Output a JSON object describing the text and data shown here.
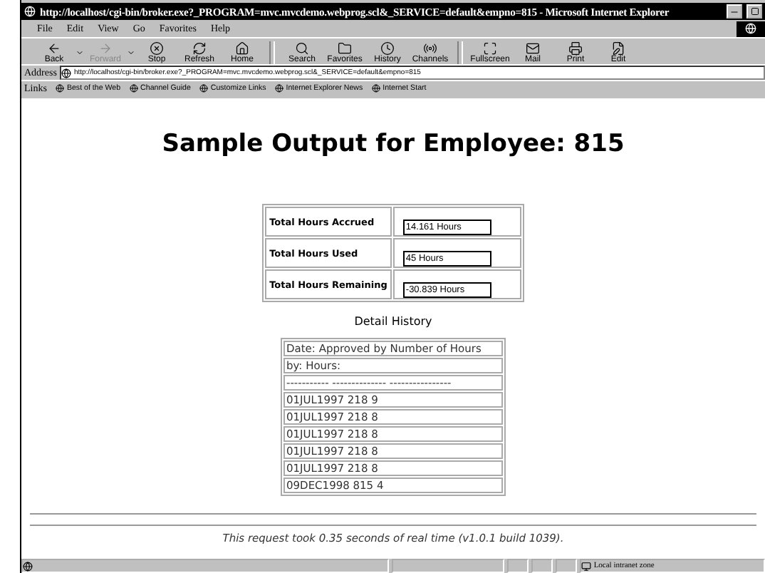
{
  "window": {
    "title": "http://localhost/cgi-bin/broker.exe?_PROGRAM=mvc.mvcdemo.webprog.scl&_SERVICE=default&empno=815 - Microsoft Internet Explorer"
  },
  "menu": [
    "File",
    "Edit",
    "View",
    "Go",
    "Favorites",
    "Help"
  ],
  "toolbar": [
    {
      "label": "Back",
      "disabled": false,
      "dropdown": true
    },
    {
      "label": "Forward",
      "disabled": true,
      "dropdown": true
    },
    {
      "label": "Stop",
      "disabled": false,
      "dropdown": false
    },
    {
      "label": "Refresh",
      "disabled": false,
      "dropdown": false
    },
    {
      "label": "Home",
      "disabled": false,
      "dropdown": false
    },
    {
      "label": "Search",
      "disabled": false,
      "dropdown": false
    },
    {
      "label": "Favorites",
      "disabled": false,
      "dropdown": false
    },
    {
      "label": "History",
      "disabled": false,
      "dropdown": false
    },
    {
      "label": "Channels",
      "disabled": false,
      "dropdown": false
    },
    {
      "label": "Fullscreen",
      "disabled": false,
      "dropdown": false
    },
    {
      "label": "Mail",
      "disabled": false,
      "dropdown": false
    },
    {
      "label": "Print",
      "disabled": false,
      "dropdown": false
    },
    {
      "label": "Edit",
      "disabled": false,
      "dropdown": false
    }
  ],
  "address": {
    "label": "Address",
    "value": "http://localhost/cgi-bin/broker.exe?_PROGRAM=mvc.mvcdemo.webprog.scl&_SERVICE=default&empno=815"
  },
  "links": {
    "label": "Links",
    "items": [
      "Best of the Web",
      "Channel Guide",
      "Customize Links",
      "Internet Explorer News",
      "Internet Start"
    ]
  },
  "page": {
    "heading": "Sample Output for Employee: 815",
    "summary": [
      {
        "label": "Total Hours Accrued",
        "value": "14.161 Hours"
      },
      {
        "label": "Total Hours Used",
        "value": "45 Hours"
      },
      {
        "label": "Total Hours Remaining",
        "value": "-30.839 Hours"
      }
    ],
    "detail_title": "Detail History",
    "detail_rows": [
      "Date: Approved by Number of Hours",
      "by: Hours:",
      "----------- -------------- ----------------",
      "01JUL1997 218 9",
      "01JUL1997 218 8",
      "01JUL1997 218 8",
      "01JUL1997 218 8",
      "01JUL1997 218 8",
      "09DEC1998 815 4"
    ],
    "footer": "This request took 0.35 seconds of real time (v1.0.1 build 1039)."
  },
  "status_bar": {
    "zone": "Local intranet zone"
  }
}
